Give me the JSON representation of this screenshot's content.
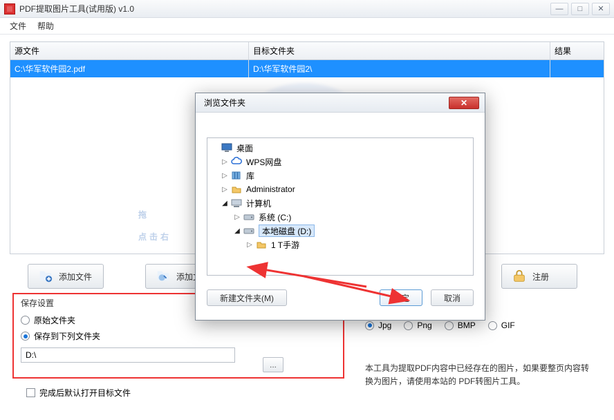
{
  "window": {
    "title": "PDF提取图片工具(试用版) v1.0",
    "min_glyph": "—",
    "max_glyph": "□",
    "close_glyph": "✕"
  },
  "menu": {
    "file": "文件",
    "help": "帮助"
  },
  "table": {
    "headers": {
      "source": "源文件",
      "target": "目标文件夹",
      "result": "结果"
    },
    "rows": [
      {
        "source": "C:\\华军软件园2.pdf",
        "target": "D:\\华军软件园2\\",
        "result": ""
      }
    ]
  },
  "watermark": {
    "line1": "拖",
    "line2": "点击右"
  },
  "buttons": {
    "add_file": "添加文件",
    "add_x": "添加文",
    "register": "注册"
  },
  "save_group": {
    "title": "保存设置",
    "radio_original": "原始文件夹",
    "radio_custom": "保存到下列文件夹",
    "path_value": "D:\\",
    "browse_glyph": "...",
    "open_after": "完成后默认打开目标文件"
  },
  "formats": {
    "jpg": "Jpg",
    "png": "Png",
    "bmp": "BMP",
    "gif": "GIF"
  },
  "description": "本工具为提取PDF内容中已经存在的图片，如果要整页内容转换为图片，请使用本站的 PDF转图片工具。",
  "dialog": {
    "title": "浏览文件夹",
    "close_glyph": "✕",
    "tree": {
      "desktop": "桌面",
      "wps": "WPS网盘",
      "library": "库",
      "admin": "Administrator",
      "computer": "计算机",
      "sys_c": "系统 (C:)",
      "local_d": "本地磁盘 (D:)",
      "game": "1   T手游"
    },
    "new_folder": "新建文件夹(M)",
    "ok": "确定",
    "cancel": "取消"
  }
}
